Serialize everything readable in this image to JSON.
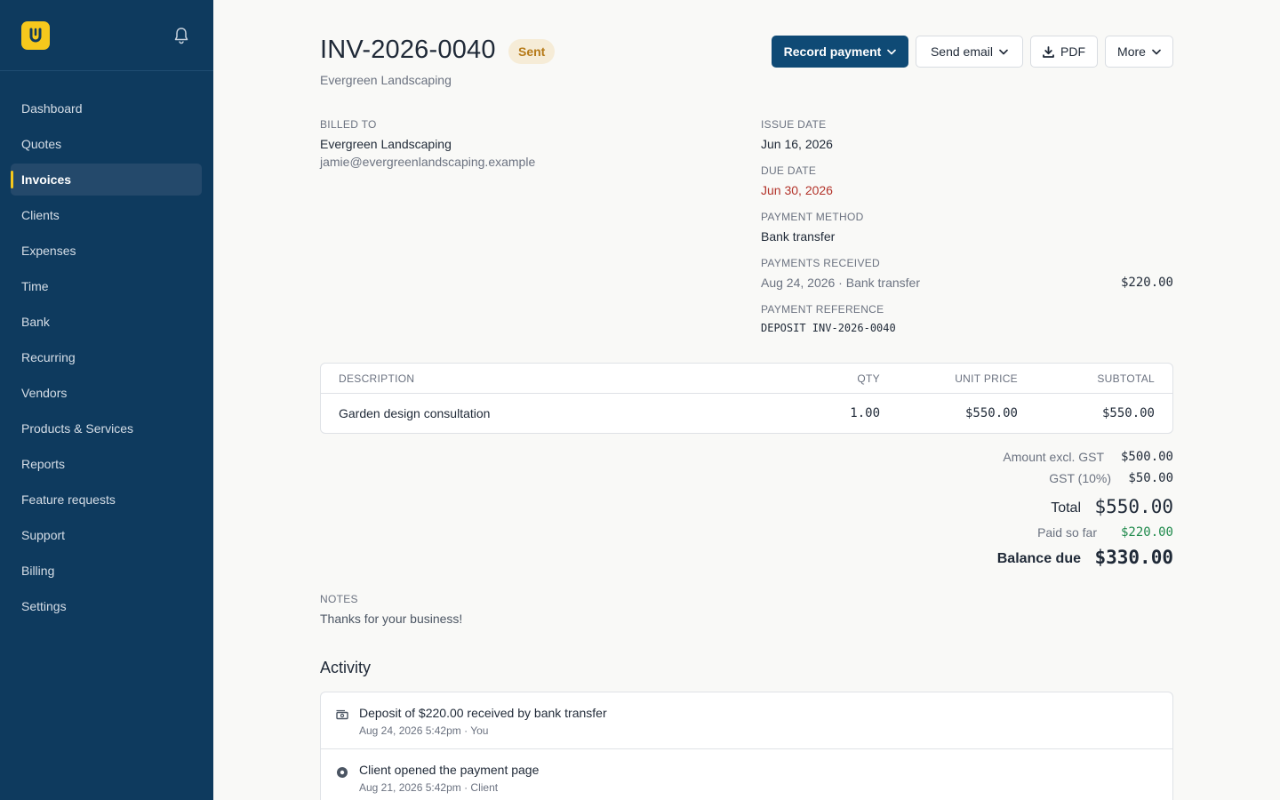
{
  "sidebar": {
    "items": [
      {
        "label": "Dashboard"
      },
      {
        "label": "Quotes"
      },
      {
        "label": "Invoices",
        "active": true
      },
      {
        "label": "Clients"
      },
      {
        "label": "Expenses"
      },
      {
        "label": "Time"
      },
      {
        "label": "Bank"
      },
      {
        "label": "Recurring"
      },
      {
        "label": "Vendors"
      },
      {
        "label": "Products & Services"
      },
      {
        "label": "Reports"
      },
      {
        "label": "Feature requests"
      },
      {
        "label": "Support"
      },
      {
        "label": "Billing"
      },
      {
        "label": "Settings"
      }
    ],
    "logo_icon": "app-logo-icon",
    "bell_icon": "bell-icon"
  },
  "invoice": {
    "number": "INV-2026-0040",
    "status": "Sent",
    "client_name": "Evergreen Landscaping"
  },
  "toolbar": {
    "record_payment": "Record payment",
    "send_email": "Send email",
    "pdf": "PDF",
    "more": "More"
  },
  "billed_to": {
    "label": "BILLED TO",
    "name": "Evergreen Landscaping",
    "email": "jamie@evergreenlandscaping.example"
  },
  "details": {
    "issue_date_label": "ISSUE DATE",
    "issue_date": "Jun 16, 2026",
    "due_date_label": "DUE DATE",
    "due_date": "Jun 30, 2026",
    "payment_method_label": "PAYMENT METHOD",
    "payment_method": "Bank transfer",
    "payments_received_label": "PAYMENTS RECEIVED",
    "payment_received_text": "Aug 24, 2026 · Bank transfer",
    "payment_received_amount": "$220.00",
    "payment_reference_label": "PAYMENT REFERENCE",
    "payment_reference": "DEPOSIT INV-2026-0040"
  },
  "table": {
    "headers": {
      "description": "DESCRIPTION",
      "qty": "QTY",
      "unit_price": "UNIT PRICE",
      "subtotal": "SUBTOTAL"
    },
    "rows": [
      {
        "description": "Garden design consultation",
        "qty": "1.00",
        "unit_price": "$550.00",
        "subtotal": "$550.00"
      }
    ]
  },
  "totals": {
    "excl_label": "Amount excl. GST",
    "excl_value": "$500.00",
    "gst_label": "GST (10%)",
    "gst_value": "$50.00",
    "total_label": "Total",
    "total_value": "$550.00",
    "paid_label": "Paid so far",
    "paid_value": "$220.00",
    "balance_label": "Balance due",
    "balance_value": "$330.00"
  },
  "notes": {
    "label": "NOTES",
    "text": "Thanks for your business!"
  },
  "activity": {
    "title": "Activity",
    "items": [
      {
        "text": "Deposit of $220.00 received by bank transfer",
        "meta": "Aug 24, 2026 5:42pm · You",
        "icon": "cash-icon"
      },
      {
        "text": "Client opened the payment page",
        "meta": "Aug 21, 2026 5:42pm · Client",
        "icon": "dot-circle-icon"
      }
    ]
  },
  "colors": {
    "sidebar_bg": "#0e3a5e",
    "accent_yellow": "#f6c81c",
    "primary_button": "#0f4a75",
    "due_date_red": "#b3342b",
    "paid_green": "#1f8a4c",
    "badge_text": "#b67a18"
  }
}
